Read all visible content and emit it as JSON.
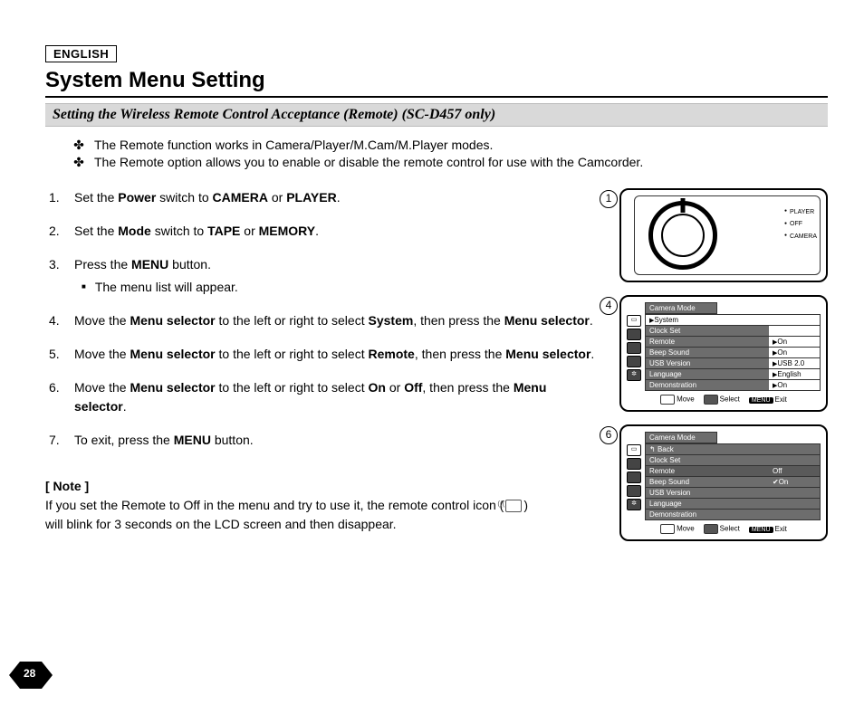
{
  "lang": "ENGLISH",
  "title": "System Menu Setting",
  "subtitle": "Setting the Wireless Remote Control Acceptance (Remote) (SC-D457 only)",
  "intro": [
    "The Remote function works in Camera/Player/M.Cam/M.Player modes.",
    "The Remote option allows you to enable or disable the remote control for use with the Camcorder."
  ],
  "steps": {
    "s1_pre": "Set the ",
    "s1_b1": "Power",
    "s1_mid": " switch to ",
    "s1_b2": "CAMERA",
    "s1_or": " or ",
    "s1_b3": "PLAYER",
    "s1_end": ".",
    "s2_pre": "Set the ",
    "s2_b1": "Mode",
    "s2_mid": " switch to ",
    "s2_b2": "TAPE",
    "s2_or": " or ",
    "s2_b3": "MEMORY",
    "s2_end": ".",
    "s3_pre": "Press the ",
    "s3_b1": "MENU",
    "s3_end": " button.",
    "s3_sub": "The menu list will appear.",
    "s4_pre": "Move the ",
    "s4_b1": "Menu selector",
    "s4_mid": " to the left or right to select ",
    "s4_b2": "System",
    "s4_mid2": ", then press the ",
    "s4_b3": "Menu selector",
    "s4_end": ".",
    "s5_pre": "Move the ",
    "s5_b1": "Menu selector",
    "s5_mid": " to the left or right to select ",
    "s5_b2": "Remote",
    "s5_mid2": ", then press the ",
    "s5_b3": "Menu selector",
    "s5_end": ".",
    "s6_pre": "Move the ",
    "s6_b1": "Menu selector",
    "s6_mid": " to the left or right to select ",
    "s6_b2": "On",
    "s6_or": " or ",
    "s6_b3": "Off",
    "s6_mid2": ", then press the ",
    "s6_b4": "Menu selector",
    "s6_end": ".",
    "s7_pre": "To exit, press the ",
    "s7_b1": "MENU",
    "s7_end": " button."
  },
  "note": {
    "label": "[ Note ]",
    "line1": "If you set the Remote to Off in the menu and try to use it, the remote control icon (",
    "line1_end": ")",
    "line2": "will blink for 3 seconds on the LCD screen and then disappear."
  },
  "fig1": {
    "num": "1",
    "labels": [
      "PLAYER",
      "OFF",
      "CAMERA"
    ]
  },
  "fig4": {
    "num": "4",
    "title": "Camera Mode",
    "items": [
      {
        "label": "System",
        "val": "",
        "sel": true
      },
      {
        "label": "Clock Set",
        "val": ""
      },
      {
        "label": "Remote",
        "val": "On"
      },
      {
        "label": "Beep Sound",
        "val": "On"
      },
      {
        "label": "USB Version",
        "val": "USB 2.0"
      },
      {
        "label": "Language",
        "val": "English"
      },
      {
        "label": "Demonstration",
        "val": "On"
      }
    ],
    "footer": {
      "move": "Move",
      "select": "Select",
      "menu": "MENU",
      "exit": "Exit"
    }
  },
  "fig6": {
    "num": "6",
    "title": "Camera Mode",
    "back": "Back",
    "items": [
      {
        "label": "Clock Set",
        "opt": ""
      },
      {
        "label": "Remote",
        "opt": "Off",
        "hl": true
      },
      {
        "label": "Beep Sound",
        "opt": "On",
        "check": true
      },
      {
        "label": "USB Version",
        "opt": ""
      },
      {
        "label": "Language",
        "opt": ""
      },
      {
        "label": "Demonstration",
        "opt": ""
      }
    ],
    "footer": {
      "move": "Move",
      "select": "Select",
      "menu": "MENU",
      "exit": "Exit"
    }
  },
  "page_number": "28"
}
